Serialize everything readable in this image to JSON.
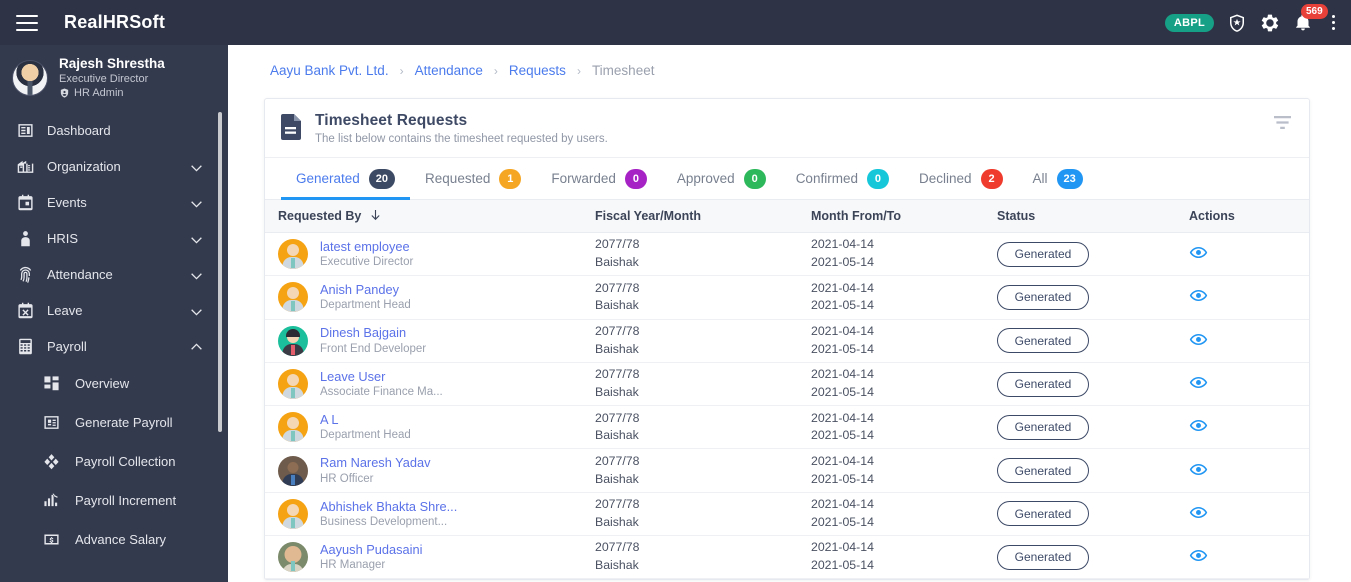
{
  "topbar": {
    "brand": "RealHRSoft",
    "menu_icon": "hamburger-icon",
    "org_badge": "ABPL",
    "shield_icon": "shield-star-icon",
    "settings_icon": "gear-icon",
    "bell_icon": "bell-icon",
    "notification_count": "569",
    "more_icon": "vertical-dots-icon"
  },
  "sidebar": {
    "profile": {
      "name": "Rajesh Shrestha",
      "role": "Executive Director",
      "tag": "HR Admin",
      "tag_icon": "user-shield-icon",
      "avatar": "user-avatar"
    },
    "items": [
      {
        "label": "Dashboard",
        "icon": "dashboard-icon",
        "expandable": false,
        "expanded": false,
        "sub": false
      },
      {
        "label": "Organization",
        "icon": "building-icon",
        "expandable": true,
        "expanded": false,
        "sub": false
      },
      {
        "label": "Events",
        "icon": "calendar-icon",
        "expandable": true,
        "expanded": false,
        "sub": false
      },
      {
        "label": "HRIS",
        "icon": "person-icon",
        "expandable": true,
        "expanded": false,
        "sub": false
      },
      {
        "label": "Attendance",
        "icon": "fingerprint-icon",
        "expandable": true,
        "expanded": false,
        "sub": false
      },
      {
        "label": "Leave",
        "icon": "calendar-x-icon",
        "expandable": true,
        "expanded": false,
        "sub": false
      },
      {
        "label": "Payroll",
        "icon": "calculator-icon",
        "expandable": true,
        "expanded": true,
        "sub": false
      },
      {
        "label": "Overview",
        "icon": "grid-icon",
        "expandable": false,
        "expanded": false,
        "sub": true
      },
      {
        "label": "Generate Payroll",
        "icon": "id-card-icon",
        "expandable": false,
        "expanded": false,
        "sub": true
      },
      {
        "label": "Payroll Collection",
        "icon": "diamonds-icon",
        "expandable": false,
        "expanded": false,
        "sub": true
      },
      {
        "label": "Payroll Increment",
        "icon": "bar-chart-up-icon",
        "expandable": false,
        "expanded": false,
        "sub": true
      },
      {
        "label": "Advance Salary",
        "icon": "money-bill-icon",
        "expandable": false,
        "expanded": false,
        "sub": true
      }
    ]
  },
  "breadcrumb": {
    "items": [
      "Aayu Bank Pvt. Ltd.",
      "Attendance",
      "Requests",
      "Timesheet"
    ],
    "separator": "›"
  },
  "card": {
    "icon": "document-icon",
    "title": "Timesheet Requests",
    "subtitle": "The list below contains the timesheet requested by users.",
    "filter_icon": "filter-icon"
  },
  "tabs": [
    {
      "label": "Generated",
      "count": "20",
      "color": "#3c4a63",
      "active": true
    },
    {
      "label": "Requested",
      "count": "1",
      "color": "#f5a623",
      "active": false
    },
    {
      "label": "Forwarded",
      "count": "0",
      "color": "#a622c4",
      "active": false
    },
    {
      "label": "Approved",
      "count": "0",
      "color": "#2eb85c",
      "active": false
    },
    {
      "label": "Confirmed",
      "count": "0",
      "color": "#16c7da",
      "active": false
    },
    {
      "label": "Declined",
      "count": "2",
      "color": "#ef3b2d",
      "active": false
    },
    {
      "label": "All",
      "count": "23",
      "color": "#2196f3",
      "active": false
    }
  ],
  "table": {
    "columns": [
      "Requested By",
      "Fiscal Year/Month",
      "Month From/To",
      "Status",
      "Actions"
    ],
    "sort_icon": "arrow-down-icon",
    "action_icon": "eye-icon",
    "rows": [
      {
        "name": "latest employee",
        "role": "Executive Director",
        "fiscal_year": "2077/78",
        "fiscal_month": "Baishak",
        "from": "2021-04-14",
        "to": "2021-05-14",
        "status": "Generated",
        "avatar": "orange"
      },
      {
        "name": "Anish Pandey",
        "role": "Department Head",
        "fiscal_year": "2077/78",
        "fiscal_month": "Baishak",
        "from": "2021-04-14",
        "to": "2021-05-14",
        "status": "Generated",
        "avatar": "orange"
      },
      {
        "name": "Dinesh Bajgain",
        "role": "Front End Developer",
        "fiscal_year": "2077/78",
        "fiscal_month": "Baishak",
        "from": "2021-04-14",
        "to": "2021-05-14",
        "status": "Generated",
        "avatar": "teal"
      },
      {
        "name": "Leave User",
        "role": "Associate Finance Ma...",
        "fiscal_year": "2077/78",
        "fiscal_month": "Baishak",
        "from": "2021-04-14",
        "to": "2021-05-14",
        "status": "Generated",
        "avatar": "orange"
      },
      {
        "name": "A L",
        "role": "Department Head",
        "fiscal_year": "2077/78",
        "fiscal_month": "Baishak",
        "from": "2021-04-14",
        "to": "2021-05-14",
        "status": "Generated",
        "avatar": "orange"
      },
      {
        "name": "Ram Naresh Yadav",
        "role": "HR Officer",
        "fiscal_year": "2077/78",
        "fiscal_month": "Baishak",
        "from": "2021-04-14",
        "to": "2021-05-14",
        "status": "Generated",
        "avatar": "photo1"
      },
      {
        "name": "Abhishek Bhakta Shre...",
        "role": "Business Development...",
        "fiscal_year": "2077/78",
        "fiscal_month": "Baishak",
        "from": "2021-04-14",
        "to": "2021-05-14",
        "status": "Generated",
        "avatar": "orange"
      },
      {
        "name": "Aayush Pudasaini",
        "role": "HR Manager",
        "fiscal_year": "2077/78",
        "fiscal_month": "Baishak",
        "from": "2021-04-14",
        "to": "2021-05-14",
        "status": "Generated",
        "avatar": "photo2"
      }
    ]
  }
}
